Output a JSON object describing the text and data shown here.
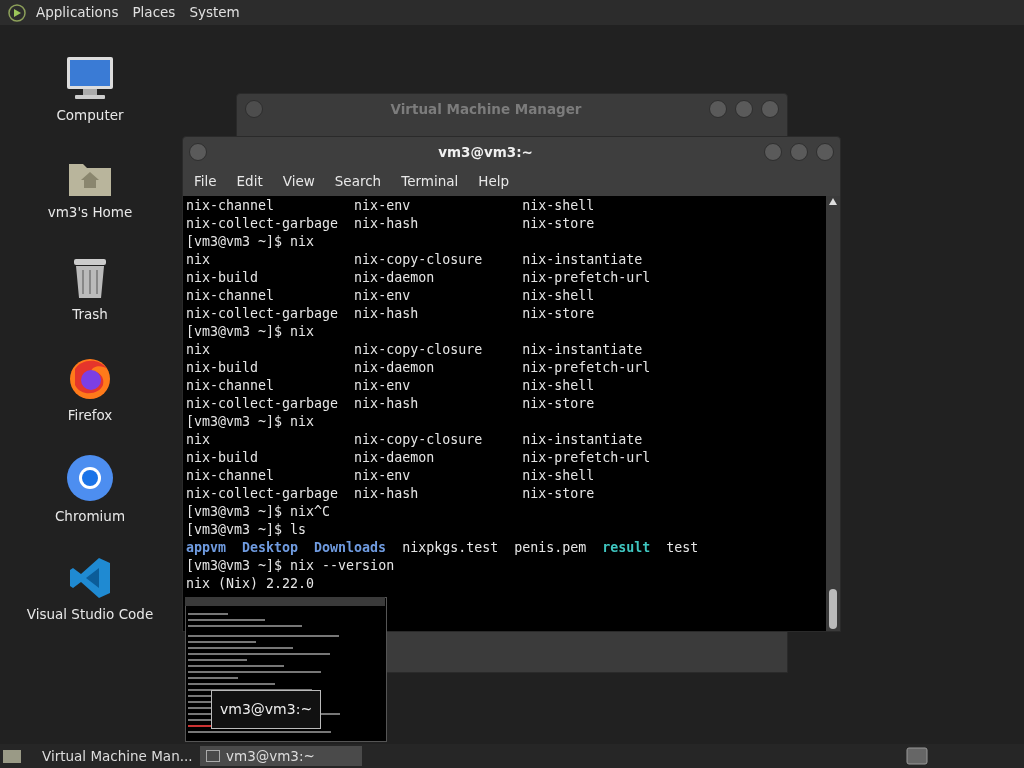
{
  "top_panel": {
    "menus": [
      "Applications",
      "Places",
      "System"
    ]
  },
  "desktop_icons": [
    {
      "kind": "computer",
      "label": "Computer"
    },
    {
      "kind": "home",
      "label": "vm3's Home"
    },
    {
      "kind": "trash",
      "label": "Trash"
    },
    {
      "kind": "firefox",
      "label": "Firefox"
    },
    {
      "kind": "chromium",
      "label": "Chromium"
    },
    {
      "kind": "vscode",
      "label": "Visual Studio Code"
    }
  ],
  "background_window": {
    "title": "Virtual Machine Manager"
  },
  "terminal": {
    "title": "vm3@vm3:~",
    "menus": [
      "File",
      "Edit",
      "View",
      "Search",
      "Terminal",
      "Help"
    ],
    "lines": [
      [
        {
          "text": "nix-channel          nix-env              nix-shell",
          "kind": "plain"
        }
      ],
      [
        {
          "text": "nix-collect-garbage  nix-hash             nix-store",
          "kind": "plain"
        }
      ],
      [
        {
          "text": "[vm3@vm3 ~]$ nix",
          "kind": "plain"
        }
      ],
      [
        {
          "text": "nix                  nix-copy-closure     nix-instantiate",
          "kind": "plain"
        }
      ],
      [
        {
          "text": "nix-build            nix-daemon           nix-prefetch-url",
          "kind": "plain"
        }
      ],
      [
        {
          "text": "nix-channel          nix-env              nix-shell",
          "kind": "plain"
        }
      ],
      [
        {
          "text": "nix-collect-garbage  nix-hash             nix-store",
          "kind": "plain"
        }
      ],
      [
        {
          "text": "[vm3@vm3 ~]$ nix",
          "kind": "plain"
        }
      ],
      [
        {
          "text": "nix                  nix-copy-closure     nix-instantiate",
          "kind": "plain"
        }
      ],
      [
        {
          "text": "nix-build            nix-daemon           nix-prefetch-url",
          "kind": "plain"
        }
      ],
      [
        {
          "text": "nix-channel          nix-env              nix-shell",
          "kind": "plain"
        }
      ],
      [
        {
          "text": "nix-collect-garbage  nix-hash             nix-store",
          "kind": "plain"
        }
      ],
      [
        {
          "text": "[vm3@vm3 ~]$ nix",
          "kind": "plain"
        }
      ],
      [
        {
          "text": "nix                  nix-copy-closure     nix-instantiate",
          "kind": "plain"
        }
      ],
      [
        {
          "text": "nix-build            nix-daemon           nix-prefetch-url",
          "kind": "plain"
        }
      ],
      [
        {
          "text": "nix-channel          nix-env              nix-shell",
          "kind": "plain"
        }
      ],
      [
        {
          "text": "nix-collect-garbage  nix-hash             nix-store",
          "kind": "plain"
        }
      ],
      [
        {
          "text": "[vm3@vm3 ~]$ nix^C",
          "kind": "plain"
        }
      ],
      [
        {
          "text": "[vm3@vm3 ~]$ ls",
          "kind": "plain"
        }
      ],
      [
        {
          "text": "appvm",
          "kind": "directory"
        },
        {
          "text": "Desktop",
          "kind": "directory"
        },
        {
          "text": "Downloads",
          "kind": "directory"
        },
        {
          "text": "nixpkgs.test",
          "kind": "plain"
        },
        {
          "text": "penis.pem",
          "kind": "plain"
        },
        {
          "text": "result",
          "kind": "link"
        },
        {
          "text": "test",
          "kind": "plain"
        }
      ],
      [
        {
          "text": "[vm3@vm3 ~]$ nix --version",
          "kind": "plain"
        }
      ],
      [
        {
          "text": "nix (Nix) 2.22.0",
          "kind": "plain"
        }
      ]
    ]
  },
  "window_preview": {
    "label": "vm3@vm3:~"
  },
  "taskbar": {
    "tasks": [
      {
        "label": "Virtual Machine Man...",
        "selected": false
      },
      {
        "label": "vm3@vm3:~",
        "selected": true
      }
    ]
  }
}
